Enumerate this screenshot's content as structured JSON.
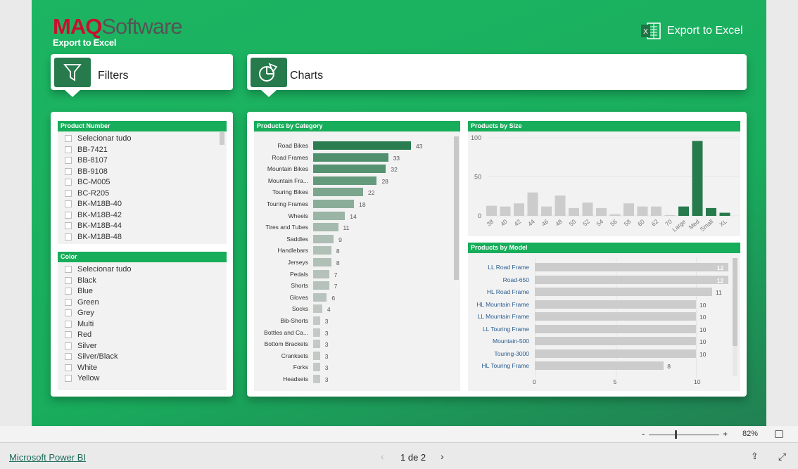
{
  "header": {
    "logo_maq": "MAQ",
    "logo_software": "Software",
    "subtitle": "Export to Excel",
    "export_button": "Export to Excel"
  },
  "tabs": {
    "filters": "Filters",
    "charts": "Charts"
  },
  "slicers": {
    "product_number": {
      "title": "Product Number",
      "items": [
        "Selecionar tudo",
        "BB-7421",
        "BB-8107",
        "BB-9108",
        "BC-M005",
        "BC-R205",
        "BK-M18B-40",
        "BK-M18B-42",
        "BK-M18B-44",
        "BK-M18B-48"
      ]
    },
    "color": {
      "title": "Color",
      "items": [
        "Selecionar tudo",
        "Black",
        "Blue",
        "Green",
        "Grey",
        "Multi",
        "Red",
        "Silver",
        "Silver/Black",
        "White",
        "Yellow"
      ]
    }
  },
  "colors": {
    "accent": "#17ad5a",
    "dark_green": "#267a4c",
    "gray_bar": "#cccccc"
  },
  "chart_data": [
    {
      "type": "bar",
      "orientation": "horizontal",
      "title": "Products by Category",
      "categories": [
        "Road Bikes",
        "Road Frames",
        "Mountain Bikes",
        "Mountain Fra...",
        "Touring Bikes",
        "Touring Frames",
        "Wheels",
        "Tires and Tubes",
        "Saddles",
        "Handlebars",
        "Jerseys",
        "Pedals",
        "Shorts",
        "Gloves",
        "Socks",
        "Bib-Shorts",
        "Bottles and Ca...",
        "Bottom Brackets",
        "Cranksets",
        "Forks",
        "Headsets"
      ],
      "values": [
        43,
        33,
        32,
        28,
        22,
        18,
        14,
        11,
        9,
        8,
        8,
        7,
        7,
        6,
        4,
        3,
        3,
        3,
        3,
        3,
        3
      ]
    },
    {
      "type": "bar",
      "title": "Products by Size",
      "categories": [
        "38",
        "40",
        "42",
        "44",
        "46",
        "48",
        "50",
        "52",
        "54",
        "56",
        "58",
        "60",
        "62",
        "70",
        "Large",
        "Med",
        "Small",
        "XL"
      ],
      "values": [
        13,
        12,
        16,
        30,
        12,
        26,
        10,
        17,
        10,
        2,
        16,
        12,
        12,
        1,
        12,
        96,
        10,
        4
      ],
      "highlighted": [
        "Large",
        "Med",
        "Small",
        "XL"
      ],
      "yticks": [
        0,
        50,
        100
      ],
      "ylim": [
        0,
        100
      ],
      "grid": true
    },
    {
      "type": "bar",
      "orientation": "horizontal",
      "title": "Products by Model",
      "categories": [
        "LL Road Frame",
        "Road-650",
        "HL Road Frame",
        "HL Mountain Frame",
        "LL Mountain Frame",
        "LL Touring Frame",
        "Mountain-500",
        "Touring-3000",
        "HL Touring Frame"
      ],
      "values": [
        12,
        12,
        11,
        10,
        10,
        10,
        10,
        10,
        8
      ],
      "xticks": [
        0,
        5,
        10
      ],
      "xlim": [
        0,
        12.5
      ]
    }
  ],
  "toolbar": {
    "zoom_minus": "-",
    "zoom_plus": "+",
    "zoom_level": "82%"
  },
  "footer": {
    "brand_link": "Microsoft Power BI",
    "page_indicator": "1 de 2"
  }
}
